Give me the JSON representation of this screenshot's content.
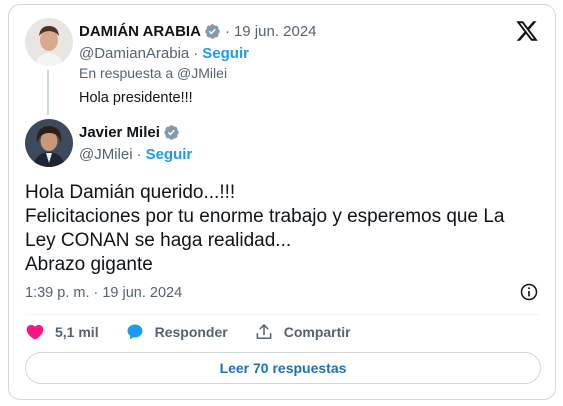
{
  "reply_tweet": {
    "author_name": "DAMIÁN ARABIA",
    "date": "19 jun. 2024",
    "handle": "@DamianArabia",
    "follow_label": "Seguir",
    "in_reply_to": "En respuesta a @JMilei",
    "text": "Hola presidente!!!"
  },
  "main_tweet": {
    "author_name": "Javier Milei",
    "handle": "@JMilei",
    "follow_label": "Seguir",
    "text_lines": [
      "Hola Damián querido...!!!",
      "Felicitaciones por tu enorme trabajo y esperemos que La",
      "Ley CONAN se haga realidad...",
      "Abrazo gigante"
    ],
    "timestamp": "1:39 p. m. · 19 jun. 2024"
  },
  "actions": {
    "likes": "5,1 mil",
    "reply_label": "Responder",
    "share_label": "Compartir"
  },
  "read_replies_label": "Leer 70 respuestas",
  "colors": {
    "accent": "#1d9bf0",
    "like": "#f91880",
    "muted": "#536471"
  }
}
